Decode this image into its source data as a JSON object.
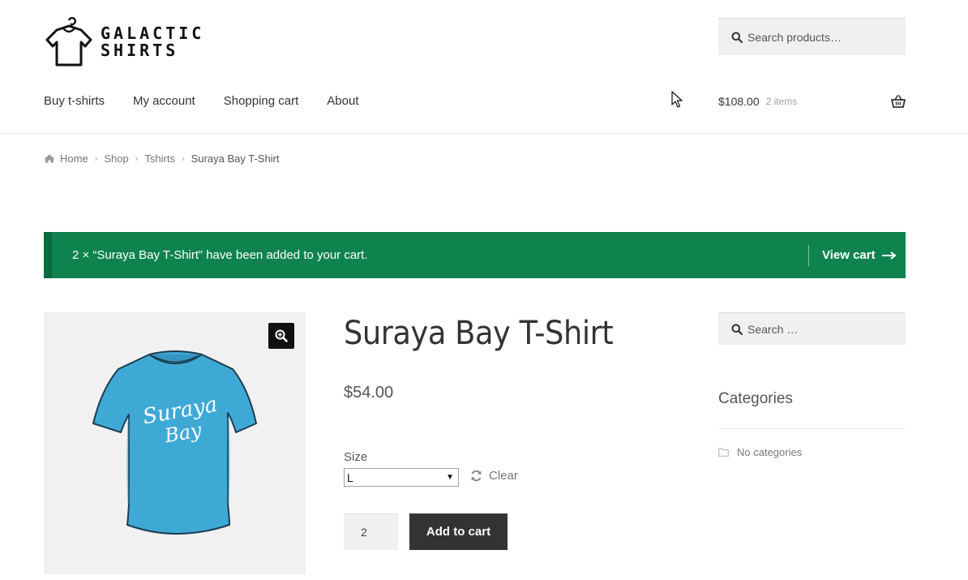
{
  "site": {
    "logo_line1": "GALACTIC",
    "logo_line2": "SHIRTS"
  },
  "header": {
    "search_placeholder": "Search products…",
    "nav": [
      {
        "label": "Buy t-shirts"
      },
      {
        "label": "My account"
      },
      {
        "label": "Shopping cart"
      },
      {
        "label": "About"
      }
    ],
    "cart_amount": "$108.00",
    "cart_count": "2 items"
  },
  "breadcrumb": {
    "home": "Home",
    "shop": "Shop",
    "category": "Tshirts",
    "current": "Suraya Bay T-Shirt"
  },
  "notice": {
    "message": "2 × “Suraya Bay T-Shirt” have been added to your cart.",
    "view_cart": "View cart"
  },
  "product": {
    "print_line1": "Suraya",
    "print_line2": "Bay",
    "title": "Suraya Bay T-Shirt",
    "price": "$54.00",
    "size_label": "Size",
    "size_value": "L",
    "clear_label": "Clear",
    "quantity": "2",
    "add_to_cart": "Add to cart"
  },
  "sidebar": {
    "search_placeholder": "Search …",
    "categories_title": "Categories",
    "no_categories": "No categories"
  },
  "colors": {
    "notice_bg": "#0f834d",
    "button_bg": "#333333",
    "shirt": "#3fa9d6"
  }
}
